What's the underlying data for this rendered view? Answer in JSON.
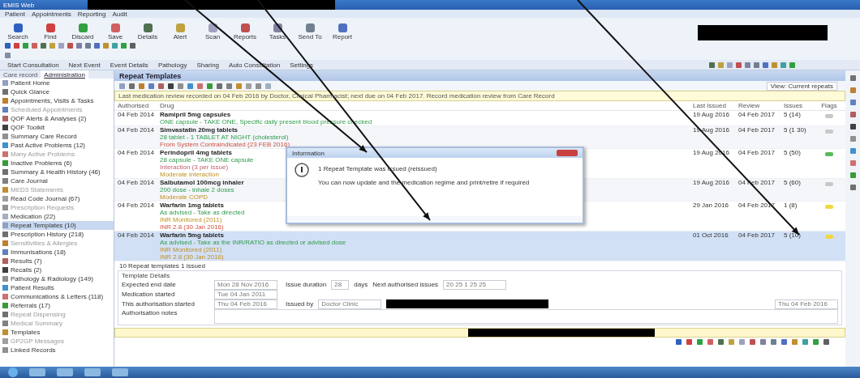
{
  "window": {
    "title": "EMIS Web",
    "redacted": true
  },
  "menu": [
    "Patient",
    "Appointments",
    "Reporting",
    "Audit"
  ],
  "toolbar": [
    {
      "label": "Search"
    },
    {
      "label": "Find"
    },
    {
      "label": "Discard"
    },
    {
      "label": "Save"
    },
    {
      "label": "Details"
    },
    {
      "label": "Alert"
    },
    {
      "label": "Scan"
    },
    {
      "label": "Reports"
    },
    {
      "label": "Tasks"
    },
    {
      "label": "Send To"
    },
    {
      "label": "Report"
    }
  ],
  "nav_tabs": [
    "Start Consultation",
    "Next Event",
    "Event Details",
    "Pathology",
    "Sharing",
    "Auto Consultation",
    "Settings"
  ],
  "sidebar": {
    "tabs": [
      {
        "label": "Care record",
        "selected": false
      },
      {
        "label": "Administration",
        "selected": true
      }
    ],
    "items": [
      {
        "label": "Patient Home",
        "selected": false,
        "disabled": false
      },
      {
        "label": "Quick Glance",
        "selected": false,
        "disabled": false
      },
      {
        "label": "Appointments, Visits & Tasks",
        "selected": false,
        "disabled": false
      },
      {
        "label": "Scheduled Appointments",
        "selected": false,
        "disabled": true
      },
      {
        "label": "QOF Alerts & Analyses (2)",
        "selected": false,
        "disabled": false
      },
      {
        "label": "QOF Toolkit",
        "selected": false,
        "disabled": false
      },
      {
        "label": "Summary Care Record",
        "selected": false,
        "disabled": false
      },
      {
        "label": "Past Active Problems (12)",
        "selected": false,
        "disabled": false
      },
      {
        "label": "Many Active Problems",
        "selected": false,
        "disabled": true
      },
      {
        "label": "Inactive Problems (6)",
        "selected": false,
        "disabled": false
      },
      {
        "label": "Summary & Health History (46)",
        "selected": false,
        "disabled": false
      },
      {
        "label": "Care Journal",
        "selected": false,
        "disabled": false
      },
      {
        "label": "MED3 Statements",
        "selected": false,
        "disabled": true
      },
      {
        "label": "Read Code Journal (67)",
        "selected": false,
        "disabled": false
      },
      {
        "label": "Prescription Requests",
        "selected": false,
        "disabled": true
      },
      {
        "label": "Medication (22)",
        "selected": false,
        "disabled": false
      },
      {
        "label": "Repeat Templates (10)",
        "selected": true,
        "disabled": false
      },
      {
        "label": "Prescription History (218)",
        "selected": false,
        "disabled": false
      },
      {
        "label": "Sensitivities & Allergies",
        "selected": false,
        "disabled": true
      },
      {
        "label": "Immunisations (18)",
        "selected": false,
        "disabled": false
      },
      {
        "label": "Results (7)",
        "selected": false,
        "disabled": false
      },
      {
        "label": "Recalls (2)",
        "selected": false,
        "disabled": false
      },
      {
        "label": "Pathology & Radiology (149)",
        "selected": false,
        "disabled": false
      },
      {
        "label": "Patient Results",
        "selected": false,
        "disabled": false
      },
      {
        "label": "Communications & Letters (118)",
        "selected": false,
        "disabled": false
      },
      {
        "label": "Referrals (17)",
        "selected": false,
        "disabled": false
      },
      {
        "label": "Repeat Dispensing",
        "selected": false,
        "disabled": true
      },
      {
        "label": "Medical Summary",
        "selected": false,
        "disabled": true
      },
      {
        "label": "Templates",
        "selected": false,
        "disabled": false
      },
      {
        "label": "GP2GP Messages",
        "selected": false,
        "disabled": true
      },
      {
        "label": "Linked Records",
        "selected": false,
        "disabled": false
      }
    ]
  },
  "panel": {
    "title": "Repeat Templates",
    "view_label": "View: Current repeats",
    "banner": "Last medication review recorded on 04 Feb 2016 by Doctor, Clinical Pharmacist; next due on 04 Feb 2017. Record medication review from Care Record",
    "columns": [
      "Authorised",
      "Drug",
      "Last Issued",
      "Review",
      "Issues",
      "Flags"
    ],
    "rows": [
      {
        "authorised": "04 Feb 2014",
        "drug": "Ramipril 5mg capsules",
        "lines": [
          {
            "text": "ONE capsule - TAKE ONE, Specific daily present blood pressure checked",
            "kind": "dosage"
          }
        ],
        "last_issued": "19 Aug 2016",
        "review": "04 Feb 2017",
        "issues": "5 (14)",
        "color": "#c8c8c8",
        "selected": false
      },
      {
        "authorised": "04 Feb 2014",
        "drug": "Simvastatin 20mg tablets",
        "lines": [
          {
            "text": "28 tablet - 1 TABLET AT NIGHT (cholesterol)",
            "kind": "dosage"
          },
          {
            "text": "From System Contraindicated (23 FEB 2016)",
            "kind": "warning"
          }
        ],
        "last_issued": "19 Aug 2016",
        "review": "04 Feb 2017",
        "issues": "5 (1 30)",
        "color": "#c8c8c8",
        "selected": false
      },
      {
        "authorised": "04 Feb 2014",
        "drug": "Perindopril 4mg tablets",
        "lines": [
          {
            "text": "28 capsule - TAKE ONE capsule",
            "kind": "dosage"
          },
          {
            "text": "Interaction (3 per issue)",
            "kind": "info"
          },
          {
            "text": "Moderate interaction",
            "kind": "caution"
          }
        ],
        "last_issued": "19 Aug 2016",
        "review": "04 Feb 2017",
        "issues": "5 (50)",
        "color": "#5cb85c",
        "selected": false
      },
      {
        "authorised": "04 Feb 2014",
        "drug": "Salbutamol 100mcg inhaler",
        "lines": [
          {
            "text": "200 dose - inhale 2 doses",
            "kind": "dosage"
          },
          {
            "text": "Moderate COPD",
            "kind": "caution"
          }
        ],
        "last_issued": "19 Aug 2016",
        "review": "04 Feb 2017",
        "issues": "5 (60)",
        "color": "#c8c8c8",
        "selected": false
      },
      {
        "authorised": "04 Feb 2014",
        "drug": "Warfarin 1mg tablets",
        "lines": [
          {
            "text": "As advised - Take as directed",
            "kind": "dosage"
          },
          {
            "text": "INR Monitored (2011)",
            "kind": "caution"
          },
          {
            "text": "INR 2.8 (30 Jan 2016)",
            "kind": "warning"
          }
        ],
        "last_issued": "29 Jan 2016",
        "review": "04 Feb 2017",
        "issues": "1 (8)",
        "color": "#f0d840",
        "selected": false
      },
      {
        "authorised": "04 Feb 2014",
        "drug": "Warfarin 5mg tablets",
        "lines": [
          {
            "text": "As advised - Take as the INR/RATIO as directed or advised dose",
            "kind": "dosage"
          },
          {
            "text": "INR Monitored (2011)",
            "kind": "caution"
          },
          {
            "text": "INR 2.8 (30 Jan 2016)",
            "kind": "caution"
          }
        ],
        "last_issued": "01 Oct 2016",
        "review": "04 Feb 2017",
        "issues": "5 (10)",
        "color": "#f0d840",
        "selected": true
      }
    ],
    "summary": "10 Repeat templates  1 issued",
    "details": {
      "title": "Template Details",
      "fields": [
        {
          "label": "Expected end date",
          "value": "Mon 28 Nov 2016"
        },
        {
          "label": "Medication started",
          "value": "Tue 04 Jan 2011"
        },
        {
          "label": "This authorisation started",
          "value": "Thu 04 Feb 2016"
        }
      ],
      "issue_duration_label": "Issue duration",
      "issue_duration": "28",
      "days": "days",
      "next_label": "Next authorised issues",
      "next_value": "20 25 1 25 25",
      "issued_by_label": "Issued by",
      "issued_by": "Doctor Clinic",
      "right_date": "Thu 04 Feb 2016",
      "notes_label": "Authorisation notes"
    }
  },
  "dialog": {
    "title": "Information",
    "message": "1 Repeat Template was issued (reissued)",
    "detail": "You can now update and the medication regime and print/retire if required"
  }
}
